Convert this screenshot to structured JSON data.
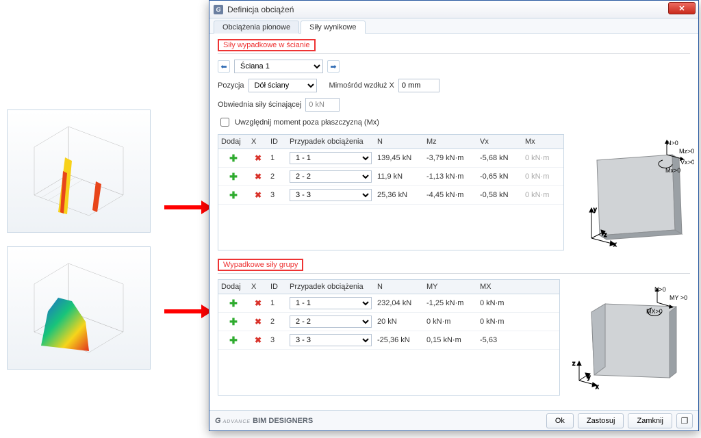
{
  "window": {
    "title": "Definicja obciążeń"
  },
  "tabs": {
    "t1": "Obciążenia pionowe",
    "t2": "Siły wynikowe"
  },
  "section1": {
    "title": "Siły wypadkowe w ścianie",
    "wall_option": "Ściana 1",
    "pozycja_label": "Pozycja",
    "pozycja_option": "Dół ściany",
    "mimos_label": "Mimośród wzdłuż X",
    "mimos_value": "0 mm",
    "obw_label": "Obwiednia siły ścinającej",
    "obw_value": "0 kN",
    "checkbox_label": "Uwzględnij moment poza płaszczyzną (Mx)",
    "headers": {
      "add": "Dodaj",
      "x": "X",
      "id": "ID",
      "case": "Przypadek obciążenia",
      "n": "N",
      "mz": "Mz",
      "vx": "Vx",
      "mx": "Mx"
    },
    "rows": [
      {
        "id": "1",
        "case": "1 - 1",
        "n": "139,45 kN",
        "mz": "-3,79 kN·m",
        "vx": "-5,68 kN",
        "mx": "0 kN·m"
      },
      {
        "id": "2",
        "case": "2 - 2",
        "n": "11,9 kN",
        "mz": "-1,13 kN·m",
        "vx": "-0,65 kN",
        "mx": "0 kN·m"
      },
      {
        "id": "3",
        "case": "3 - 3",
        "n": "25,36 kN",
        "mz": "-4,45 kN·m",
        "vx": "-0,58 kN",
        "mx": "0 kN·m"
      }
    ],
    "labels3d": {
      "n": "N>0",
      "mz": "Mz>0",
      "vx": "Vx>0",
      "mx": "Mx>0"
    }
  },
  "section2": {
    "title": "Wypadkowe siły grupy",
    "headers": {
      "add": "Dodaj",
      "x": "X",
      "id": "ID",
      "case": "Przypadek obciążenia",
      "n": "N",
      "my": "MY",
      "mx": "MX"
    },
    "rows": [
      {
        "id": "1",
        "case": "1 - 1",
        "n": "232,04 kN",
        "my": "-1,25 kN·m",
        "mx": "0 kN·m"
      },
      {
        "id": "2",
        "case": "2 - 2",
        "n": "20 kN",
        "my": "0 kN·m",
        "mx": "0 kN·m"
      },
      {
        "id": "3",
        "case": "3 - 3",
        "n": "-25,36 kN",
        "my": "0,15 kN·m",
        "mx": "-5,63"
      }
    ],
    "labels3d": {
      "n": "N>0",
      "my": "MY >0",
      "mx": "MX>0"
    }
  },
  "footer": {
    "brand_pre": "ADVANCE",
    "brand_main": "BIM DESIGNERS",
    "ok": "Ok",
    "apply": "Zastosuj",
    "close": "Zamknij"
  }
}
